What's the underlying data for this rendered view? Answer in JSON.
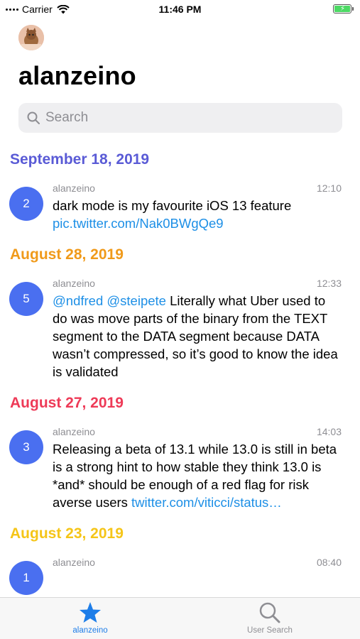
{
  "status_bar": {
    "carrier": "Carrier",
    "time": "11:46 PM",
    "battery_state": "charging",
    "battery_color": "#4cd964"
  },
  "header": {
    "avatar_icon": "user-avatar-icon",
    "title": "alanzeino"
  },
  "search": {
    "placeholder": "Search",
    "value": ""
  },
  "timeline": {
    "sections": [
      {
        "date": "September 18, 2019",
        "color": "#5a5bd6",
        "tweets": [
          {
            "count": "2",
            "author": "alanzeino",
            "time": "12:10",
            "text_parts": [
              {
                "text": "dark mode is my favourite iOS 13 feature ",
                "link": false
              },
              {
                "text": "pic.twitter.com/Nak0BWgQe9",
                "link": true
              }
            ]
          }
        ]
      },
      {
        "date": "August 28, 2019",
        "color": "#f09a1a",
        "tweets": [
          {
            "count": "5",
            "author": "alanzeino",
            "time": "12:33",
            "text_parts": [
              {
                "text": "@ndfred @steipete",
                "link": true
              },
              {
                "text": " Literally what Uber used to do was move parts of the binary from the TEXT segment to the DATA segment because DATA wasn’t compressed, so it’s good to know the idea is validated",
                "link": false
              }
            ]
          }
        ]
      },
      {
        "date": "August 27, 2019",
        "color": "#ee3a57",
        "tweets": [
          {
            "count": "3",
            "author": "alanzeino",
            "time": "14:03",
            "text_parts": [
              {
                "text": "Releasing a beta of 13.1 while 13.0 is still in beta is a strong hint to how stable they think 13.0 is *and* should be enough of a red flag for risk averse users ",
                "link": false
              },
              {
                "text": "twitter.com/viticci/status…",
                "link": true
              }
            ]
          }
        ]
      },
      {
        "date": "August 23, 2019",
        "color": "#f5c518",
        "tweets": [
          {
            "count": "1",
            "author": "alanzeino",
            "time": "08:40",
            "text_parts": []
          }
        ]
      }
    ]
  },
  "tab_bar": {
    "tabs": [
      {
        "label": "alanzeino",
        "icon": "star-icon",
        "active": true
      },
      {
        "label": "User Search",
        "icon": "search-icon",
        "active": false
      }
    ],
    "active_color": "#1d7de8"
  }
}
